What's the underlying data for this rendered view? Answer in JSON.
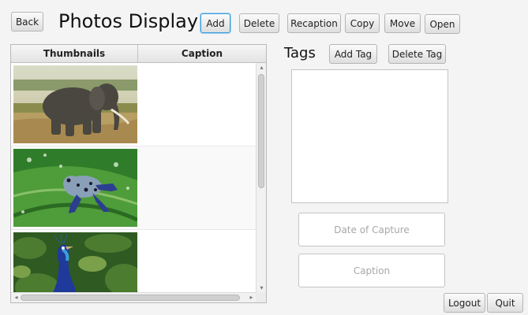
{
  "header": {
    "back_label": "Back",
    "title": "Photos Display",
    "add_label": "Add",
    "delete_label": "Delete",
    "reception_label": "Recaption",
    "copy_label": "Copy",
    "move_label": "Move",
    "open_label": "Open"
  },
  "table": {
    "columns": [
      "Thumbnails",
      "Caption"
    ],
    "rows": [
      {
        "thumbnail": "elephant-photo",
        "caption": ""
      },
      {
        "thumbnail": "frog-photo",
        "caption": ""
      },
      {
        "thumbnail": "peacock-photo",
        "caption": ""
      }
    ]
  },
  "tags": {
    "title": "Tags",
    "add_tag_label": "Add Tag",
    "delete_tag_label": "Delete Tag",
    "items": []
  },
  "fields": {
    "date_placeholder": "Date of Capture",
    "caption_placeholder": "Caption"
  },
  "footer": {
    "logout_label": "Logout",
    "quit_label": "Quit"
  },
  "colors": {
    "focus_accent": "#3a9ad9",
    "window_bg": "#f4f4f4"
  }
}
